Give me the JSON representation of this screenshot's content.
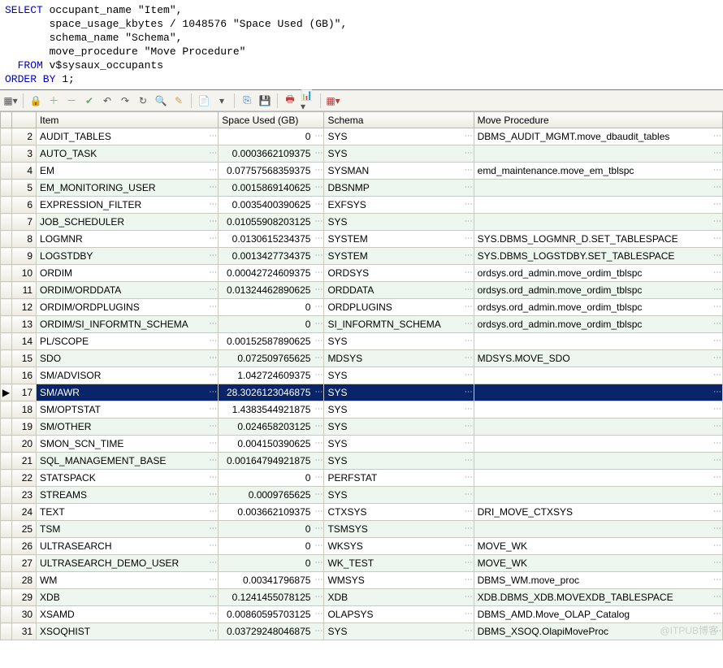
{
  "sql": {
    "line1_kw": "SELECT",
    "line1_rest": " occupant_name \"Item\",",
    "line2": "       space_usage_kbytes / 1048576 \"Space Used (GB)\",",
    "line3": "       schema_name \"Schema\",",
    "line4": "       move_procedure \"Move Procedure\"",
    "line5_kw": "  FROM",
    "line5_rest": " v$sysaux_occupants",
    "line6_kw": "ORDER BY",
    "line6_rest": " 1;"
  },
  "toolbar_icons": [
    "grid",
    "lock",
    "plus",
    "minus",
    "check",
    "undo1",
    "undo2",
    "refresh",
    "binoc",
    "pencil",
    "copy",
    "del",
    "link",
    "save",
    "drum",
    "chart",
    "tbl"
  ],
  "columns": {
    "item": "Item",
    "space": "Space Used (GB)",
    "schema": "Schema",
    "move": "Move Procedure"
  },
  "selected_row_index": 15,
  "rows": [
    {
      "n": 2,
      "item": "AUDIT_TABLES",
      "space": "0",
      "schema": "SYS",
      "move": "DBMS_AUDIT_MGMT.move_dbaudit_tables"
    },
    {
      "n": 3,
      "item": "AUTO_TASK",
      "space": "0.0003662109375",
      "schema": "SYS",
      "move": ""
    },
    {
      "n": 4,
      "item": "EM",
      "space": "0.07757568359375",
      "schema": "SYSMAN",
      "move": "emd_maintenance.move_em_tblspc"
    },
    {
      "n": 5,
      "item": "EM_MONITORING_USER",
      "space": "0.0015869140625",
      "schema": "DBSNMP",
      "move": ""
    },
    {
      "n": 6,
      "item": "EXPRESSION_FILTER",
      "space": "0.0035400390625",
      "schema": "EXFSYS",
      "move": ""
    },
    {
      "n": 7,
      "item": "JOB_SCHEDULER",
      "space": "0.01055908203125",
      "schema": "SYS",
      "move": ""
    },
    {
      "n": 8,
      "item": "LOGMNR",
      "space": "0.0130615234375",
      "schema": "SYSTEM",
      "move": "SYS.DBMS_LOGMNR_D.SET_TABLESPACE"
    },
    {
      "n": 9,
      "item": "LOGSTDBY",
      "space": "0.0013427734375",
      "schema": "SYSTEM",
      "move": "SYS.DBMS_LOGSTDBY.SET_TABLESPACE"
    },
    {
      "n": 10,
      "item": "ORDIM",
      "space": "0.00042724609375",
      "schema": "ORDSYS",
      "move": "ordsys.ord_admin.move_ordim_tblspc"
    },
    {
      "n": 11,
      "item": "ORDIM/ORDDATA",
      "space": "0.01324462890625",
      "schema": "ORDDATA",
      "move": "ordsys.ord_admin.move_ordim_tblspc"
    },
    {
      "n": 12,
      "item": "ORDIM/ORDPLUGINS",
      "space": "0",
      "schema": "ORDPLUGINS",
      "move": "ordsys.ord_admin.move_ordim_tblspc"
    },
    {
      "n": 13,
      "item": "ORDIM/SI_INFORMTN_SCHEMA",
      "space": "0",
      "schema": "SI_INFORMTN_SCHEMA",
      "move": "ordsys.ord_admin.move_ordim_tblspc"
    },
    {
      "n": 14,
      "item": "PL/SCOPE",
      "space": "0.00152587890625",
      "schema": "SYS",
      "move": ""
    },
    {
      "n": 15,
      "item": "SDO",
      "space": "0.072509765625",
      "schema": "MDSYS",
      "move": "MDSYS.MOVE_SDO"
    },
    {
      "n": 16,
      "item": "SM/ADVISOR",
      "space": "1.042724609375",
      "schema": "SYS",
      "move": ""
    },
    {
      "n": 17,
      "item": "SM/AWR",
      "space": "28.3026123046875",
      "schema": "SYS",
      "move": ""
    },
    {
      "n": 18,
      "item": "SM/OPTSTAT",
      "space": "1.4383544921875",
      "schema": "SYS",
      "move": ""
    },
    {
      "n": 19,
      "item": "SM/OTHER",
      "space": "0.024658203125",
      "schema": "SYS",
      "move": ""
    },
    {
      "n": 20,
      "item": "SMON_SCN_TIME",
      "space": "0.004150390625",
      "schema": "SYS",
      "move": ""
    },
    {
      "n": 21,
      "item": "SQL_MANAGEMENT_BASE",
      "space": "0.00164794921875",
      "schema": "SYS",
      "move": ""
    },
    {
      "n": 22,
      "item": "STATSPACK",
      "space": "0",
      "schema": "PERFSTAT",
      "move": ""
    },
    {
      "n": 23,
      "item": "STREAMS",
      "space": "0.0009765625",
      "schema": "SYS",
      "move": ""
    },
    {
      "n": 24,
      "item": "TEXT",
      "space": "0.003662109375",
      "schema": "CTXSYS",
      "move": "DRI_MOVE_CTXSYS"
    },
    {
      "n": 25,
      "item": "TSM",
      "space": "0",
      "schema": "TSMSYS",
      "move": ""
    },
    {
      "n": 26,
      "item": "ULTRASEARCH",
      "space": "0",
      "schema": "WKSYS",
      "move": "MOVE_WK"
    },
    {
      "n": 27,
      "item": "ULTRASEARCH_DEMO_USER",
      "space": "0",
      "schema": "WK_TEST",
      "move": "MOVE_WK"
    },
    {
      "n": 28,
      "item": "WM",
      "space": "0.00341796875",
      "schema": "WMSYS",
      "move": "DBMS_WM.move_proc"
    },
    {
      "n": 29,
      "item": "XDB",
      "space": "0.1241455078125",
      "schema": "XDB",
      "move": "XDB.DBMS_XDB.MOVEXDB_TABLESPACE"
    },
    {
      "n": 30,
      "item": "XSAMD",
      "space": "0.00860595703125",
      "schema": "OLAPSYS",
      "move": "DBMS_AMD.Move_OLAP_Catalog"
    },
    {
      "n": 31,
      "item": "XSOQHIST",
      "space": "0.03729248046875",
      "schema": "SYS",
      "move": "DBMS_XSOQ.OlapiMoveProc"
    }
  ],
  "watermark": "@ITPUB博客"
}
